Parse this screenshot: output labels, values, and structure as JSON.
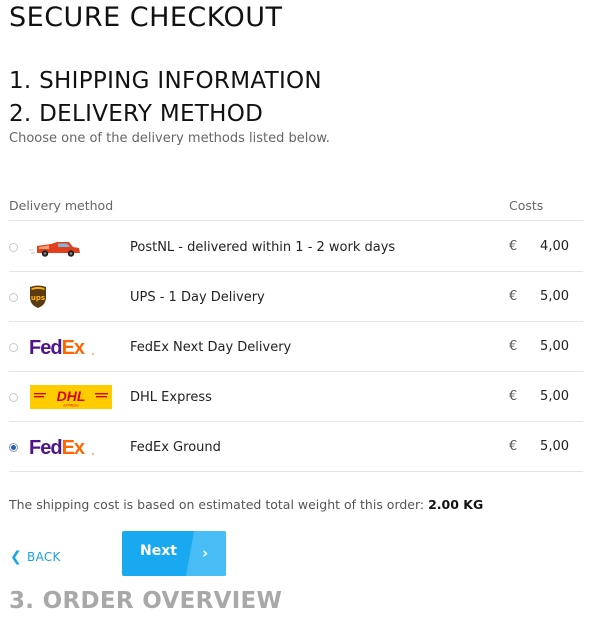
{
  "page": {
    "title": "SECURE CHECKOUT"
  },
  "steps": {
    "shipping": "1. SHIPPING INFORMATION",
    "delivery": "2. DELIVERY METHOD",
    "delivery_subtitle": "Choose one of the delivery methods listed below.",
    "overview": "3. ORDER OVERVIEW"
  },
  "table": {
    "col_method": "Delivery method",
    "col_costs": "Costs",
    "rows": [
      {
        "logo": "postnl-van-icon",
        "label": "PostNL - delivered within 1 - 2 work days",
        "currency": "€",
        "price": "4,00",
        "selected": false
      },
      {
        "logo": "ups-logo",
        "label": "UPS - 1 Day Delivery",
        "currency": "€",
        "price": "5,00",
        "selected": false
      },
      {
        "logo": "fedex-logo",
        "label": "FedEx Next Day Delivery",
        "currency": "€",
        "price": "5,00",
        "selected": false
      },
      {
        "logo": "dhl-logo",
        "label": "DHL Express",
        "currency": "€",
        "price": "5,00",
        "selected": false
      },
      {
        "logo": "fedex-logo",
        "label": "FedEx Ground",
        "currency": "€",
        "price": "5,00",
        "selected": true
      }
    ]
  },
  "logos": {
    "ups_text": "ups",
    "fedex_fed": "Fed",
    "fedex_ex": "Ex",
    "dhl_text": "DHL",
    "dhl_sub": "EXPRESS"
  },
  "shipping_note": {
    "text": "The shipping cost is based on estimated total weight of this order: ",
    "weight": "2.00 KG"
  },
  "nav": {
    "back_label": "BACK",
    "back_chevron": "❮",
    "next_label": "Next",
    "next_chevron": "›"
  },
  "colors": {
    "accent": "#19a9f0",
    "fedex_purple": "#4d148c",
    "fedex_orange": "#ff6600",
    "dhl_yellow": "#ffcc00",
    "dhl_red": "#d40511",
    "ups_brown": "#5a3a12",
    "ups_gold": "#ffb500"
  }
}
